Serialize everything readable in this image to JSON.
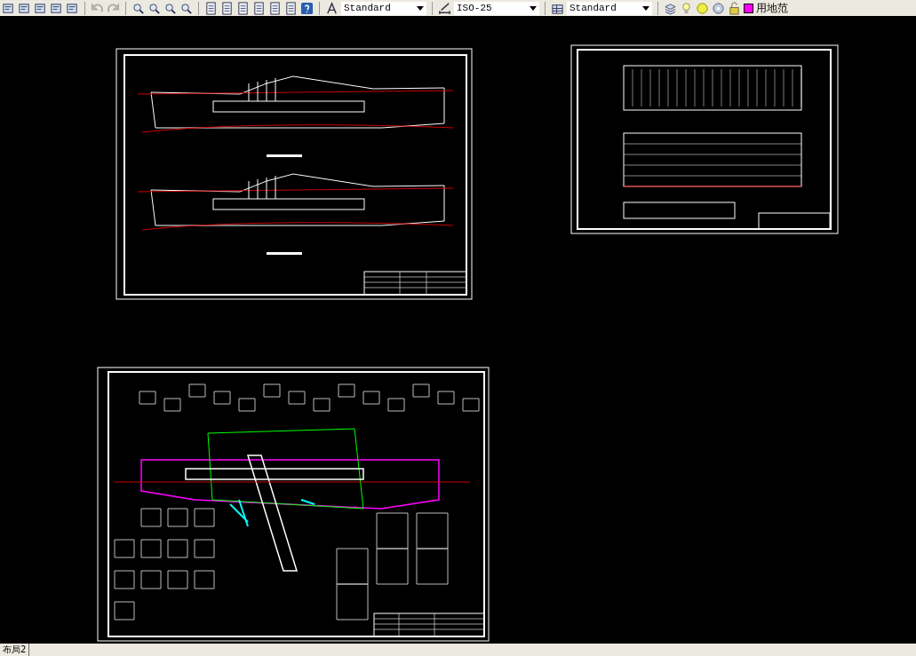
{
  "toolbar": {
    "dropdowns": [
      {
        "kind": "text-style",
        "value": "Standard"
      },
      {
        "kind": "dim-style",
        "value": "ISO-25"
      },
      {
        "kind": "table-style",
        "value": "Standard"
      }
    ],
    "layer": {
      "name": "用地范"
    }
  },
  "layout_tabs": [
    {
      "label": "布局2"
    }
  ]
}
